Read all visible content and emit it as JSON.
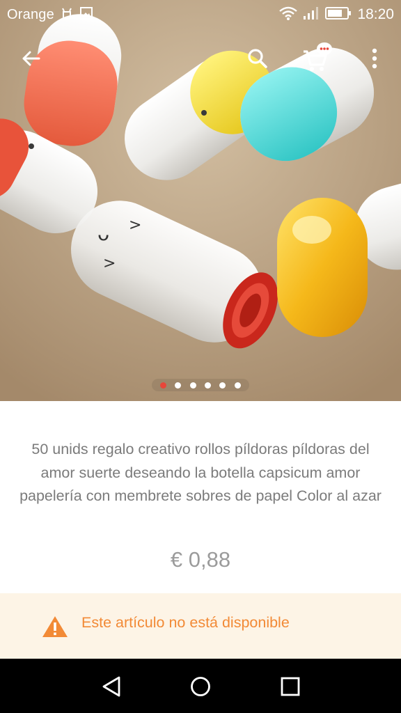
{
  "status_bar": {
    "carrier": "Orange",
    "time": "18:20",
    "icons": [
      "android-debug-icon",
      "gallery-icon",
      "wifi-icon",
      "signal-icon",
      "battery-icon"
    ]
  },
  "toolbar": {
    "icons": [
      "back-arrow-icon",
      "search-icon",
      "cart-chat-icon",
      "more-vert-icon"
    ],
    "cart_badge": "..."
  },
  "gallery": {
    "image": "product-photo-pill-capsules",
    "page_count": 6,
    "active_index": 0
  },
  "product": {
    "title": "50 unids regalo creativo rollos píldoras píldoras del amor suerte deseando la botella capsicum amor papelería con membrete sobres de papel Color al azar",
    "price": "€ 0,88"
  },
  "availability": {
    "message": "Este artículo no está disponible",
    "icon": "warning-icon"
  },
  "nav_bar": {
    "icons": [
      "nav-back-icon",
      "nav-home-icon",
      "nav-recent-icon"
    ]
  },
  "colors": {
    "accent_red": "#e8463a",
    "warning_orange": "#f28a36",
    "banner_bg": "#fdf4e6",
    "text_gray": "#7b7b7b"
  }
}
